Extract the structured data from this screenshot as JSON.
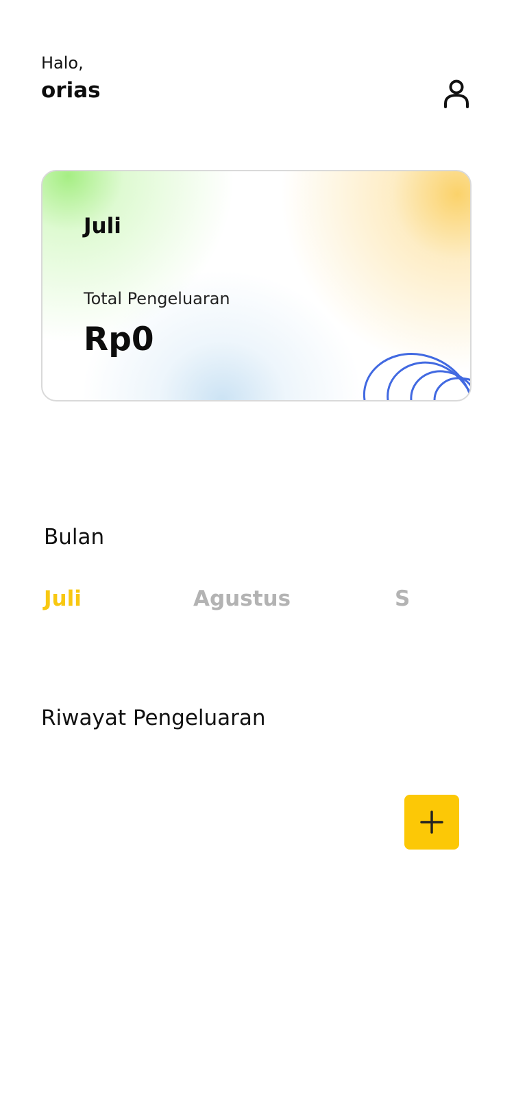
{
  "header": {
    "greeting": "Halo,",
    "username": "orias",
    "profile_icon": "user-icon"
  },
  "summary_card": {
    "month": "Juli",
    "label": "Total Pengeluaran",
    "amount": "Rp0"
  },
  "months": {
    "title": "Bulan",
    "tabs": [
      {
        "label": "Juli",
        "active": true
      },
      {
        "label": "Agustus",
        "active": false
      },
      {
        "label": "S",
        "active": false
      }
    ]
  },
  "history": {
    "title": "Riwayat Pengeluaran"
  },
  "add_button": {
    "icon": "plus-icon"
  },
  "colors": {
    "accent": "#fcc806",
    "active_tab": "#f8c811",
    "inactive_tab": "#b3b3b3",
    "decoration": "#4169e1"
  }
}
